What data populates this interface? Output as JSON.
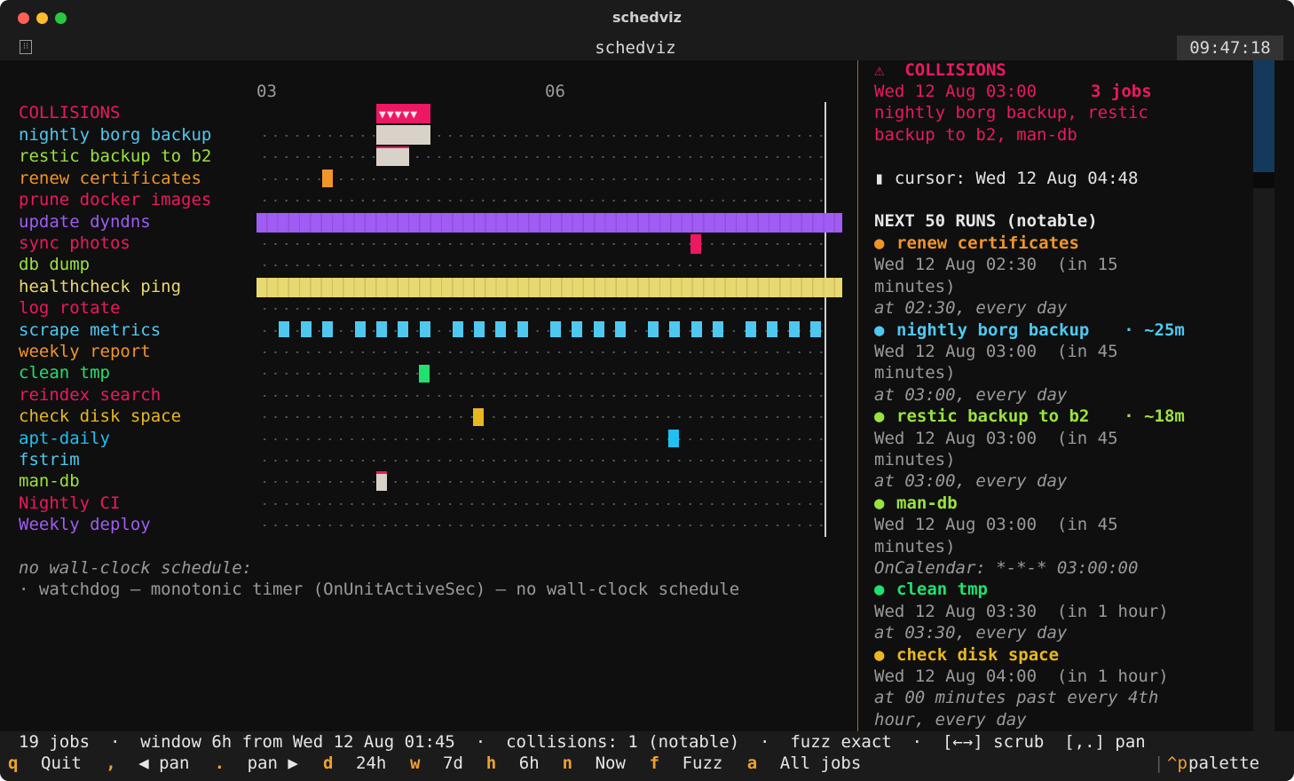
{
  "window": {
    "title": "schedviz"
  },
  "tab": {
    "title": "schedviz",
    "clock": "09:47:18"
  },
  "timeline": {
    "tick_labels": [
      "03",
      "06"
    ],
    "collisions_label": "COLLISIONS",
    "jobs": [
      {
        "name": "nightly borg backup",
        "color": "#4fc8f0"
      },
      {
        "name": "restic backup to b2",
        "color": "#9be23e"
      },
      {
        "name": "renew certificates",
        "color": "#f0952a"
      },
      {
        "name": "prune docker images",
        "color": "#ec1863"
      },
      {
        "name": "update dyndns",
        "color": "#a05cf4"
      },
      {
        "name": "sync photos",
        "color": "#ec1863"
      },
      {
        "name": "db dump",
        "color": "#9be23e"
      },
      {
        "name": "healthcheck ping",
        "color": "#e8d870"
      },
      {
        "name": "log rotate",
        "color": "#ec1863"
      },
      {
        "name": "scrape metrics",
        "color": "#4fc8f0"
      },
      {
        "name": "weekly report",
        "color": "#f0952a"
      },
      {
        "name": "clean tmp",
        "color": "#20e070"
      },
      {
        "name": "reindex search",
        "color": "#ec1863"
      },
      {
        "name": "check disk space",
        "color": "#e8b820"
      },
      {
        "name": "apt-daily",
        "color": "#20c0f0"
      },
      {
        "name": "fstrim",
        "color": "#4fc8f0"
      },
      {
        "name": "man-db",
        "color": "#9be23e"
      },
      {
        "name": "Nightly CI",
        "color": "#ec1863"
      },
      {
        "name": "Weekly deploy",
        "color": "#a05cf4"
      }
    ],
    "no_wallclock_heading": "no wall-clock schedule:",
    "no_wallclock_item": "· watchdog — monotonic timer (OnUnitActiveSec) — no wall-clock schedule"
  },
  "panel": {
    "collisions_title": "⚠  COLLISIONS",
    "collision_time": "Wed 12 Aug 03:00",
    "collision_count": "3 jobs",
    "collision_jobs_1": "nightly borg backup, restic",
    "collision_jobs_2": "backup to b2, man-db",
    "cursor": "▮ cursor: Wed 12 Aug 04:48",
    "next_title": "NEXT 50 RUNS (notable)",
    "runs": [
      {
        "bullet": "●",
        "name": "renew certificates",
        "extra": "",
        "color": "#f0952a",
        "when": "Wed 12 Aug 02:30  (in 15",
        "when2": "minutes)",
        "desc": "at 02:30, every day",
        "desc2": ""
      },
      {
        "bullet": "●",
        "name": "nightly borg backup",
        "extra": "· ~25m",
        "color": "#4fc8f0",
        "when": "Wed 12 Aug 03:00  (in 45",
        "when2": "minutes)",
        "desc": "at 03:00, every day",
        "desc2": ""
      },
      {
        "bullet": "●",
        "name": "restic backup to b2",
        "extra": "· ~18m",
        "color": "#9be23e",
        "when": "Wed 12 Aug 03:00  (in 45",
        "when2": "minutes)",
        "desc": "at 03:00, every day",
        "desc2": ""
      },
      {
        "bullet": "●",
        "name": "man-db",
        "extra": "",
        "color": "#9be23e",
        "when": "Wed 12 Aug 03:00  (in 45",
        "when2": "minutes)",
        "desc": "OnCalendar: *-*-* 03:00:00",
        "desc2": ""
      },
      {
        "bullet": "●",
        "name": "clean tmp",
        "extra": "",
        "color": "#20e070",
        "when": "Wed 12 Aug 03:30  (in 1 hour)",
        "when2": "",
        "desc": "at 03:30, every day",
        "desc2": ""
      },
      {
        "bullet": "●",
        "name": "check disk space",
        "extra": "",
        "color": "#e8b820",
        "when": "Wed 12 Aug 04:00  (in 1 hour)",
        "when2": "",
        "desc": "at 00 minutes past every 4th",
        "desc2": "hour, every day"
      }
    ]
  },
  "status": {
    "line1": "19 jobs  ·  window 6h from Wed 12 Aug 01:45  ·  collisions: 1 (notable)  ·  fuzz exact  ·  [←→] scrub  [,.] pan",
    "keys": [
      {
        "k": "q",
        "label": "Quit"
      },
      {
        "k": ",",
        "label": "◀ pan"
      },
      {
        "k": ".",
        "label": "pan ▶"
      },
      {
        "k": "d",
        "label": "24h"
      },
      {
        "k": "w",
        "label": "7d"
      },
      {
        "k": "h",
        "label": "6h"
      },
      {
        "k": "n",
        "label": "Now"
      },
      {
        "k": "f",
        "label": "Fuzz"
      },
      {
        "k": "a",
        "label": "All jobs"
      }
    ],
    "palette_key": "^p",
    "palette_label": "palette"
  },
  "colors": {
    "collision": "#ec1863",
    "muted": "#9a9a9a",
    "text": "#e6e6e6",
    "accent": "#f0a030"
  }
}
